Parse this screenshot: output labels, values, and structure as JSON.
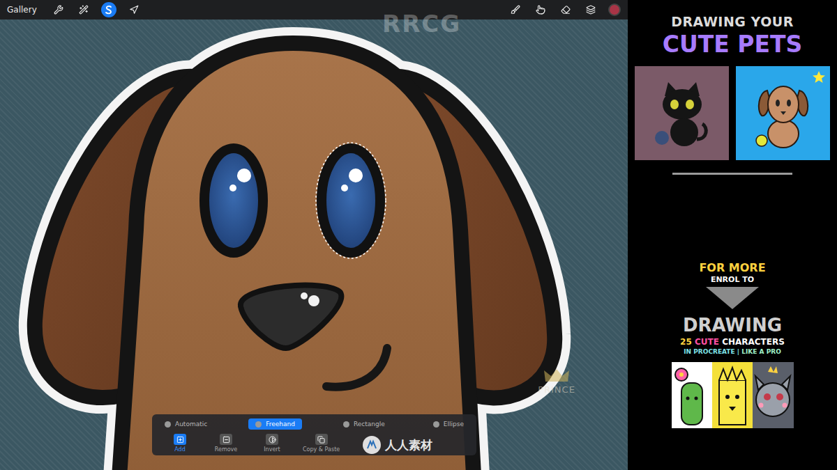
{
  "toolbar": {
    "gallery": "Gallery",
    "tools": [
      {
        "kind": "actions",
        "selected": false
      },
      {
        "kind": "adjustments",
        "selected": false
      },
      {
        "kind": "selection",
        "selected": true
      },
      {
        "kind": "transform",
        "selected": false
      }
    ],
    "paint_tools": [
      {
        "kind": "brush",
        "selected": false
      },
      {
        "kind": "smudge",
        "selected": false
      },
      {
        "kind": "eraser",
        "selected": false
      },
      {
        "kind": "layers",
        "selected": false
      }
    ],
    "color": "#a83446"
  },
  "selection_modes": [
    {
      "label": "Automatic",
      "selected": false
    },
    {
      "label": "Freehand",
      "selected": true
    },
    {
      "label": "Rectangle",
      "selected": false
    },
    {
      "label": "Ellipse",
      "selected": false
    }
  ],
  "selection_actions": [
    {
      "label": "Add",
      "kind": "add",
      "selected": true
    },
    {
      "label": "Remove",
      "kind": "remove",
      "selected": false
    },
    {
      "label": "Invert",
      "kind": "invert",
      "selected": false
    },
    {
      "label": "Copy & Paste",
      "kind": "copy",
      "selected": false
    }
  ],
  "watermarks": {
    "top": "RRCG",
    "site": "人人素材",
    "brand": "PRINCE"
  },
  "promo": {
    "kicker": "DRAWING YOUR",
    "title": "CUTE PETS",
    "pets": [
      {
        "kind": "cat",
        "color": "#7b5a68",
        "starred": false
      },
      {
        "kind": "dog",
        "color": "#2aa7ea",
        "starred": true
      }
    ],
    "cta": "FOR MORE",
    "cta_sub": "ENROL TO",
    "course_title": "DRAWING",
    "course_line": [
      {
        "text": "25",
        "color": "#ffd23f"
      },
      {
        "text": "CUTE",
        "color": "#ff4fa3"
      },
      {
        "text": "CHARACTERS",
        "color": "#ffffff"
      }
    ],
    "course_sub": [
      {
        "text": "IN PROCREATE |",
        "color": "#7ee3e8"
      },
      {
        "text": "LIKE A PRO",
        "color": "#9ff0c8"
      }
    ]
  }
}
